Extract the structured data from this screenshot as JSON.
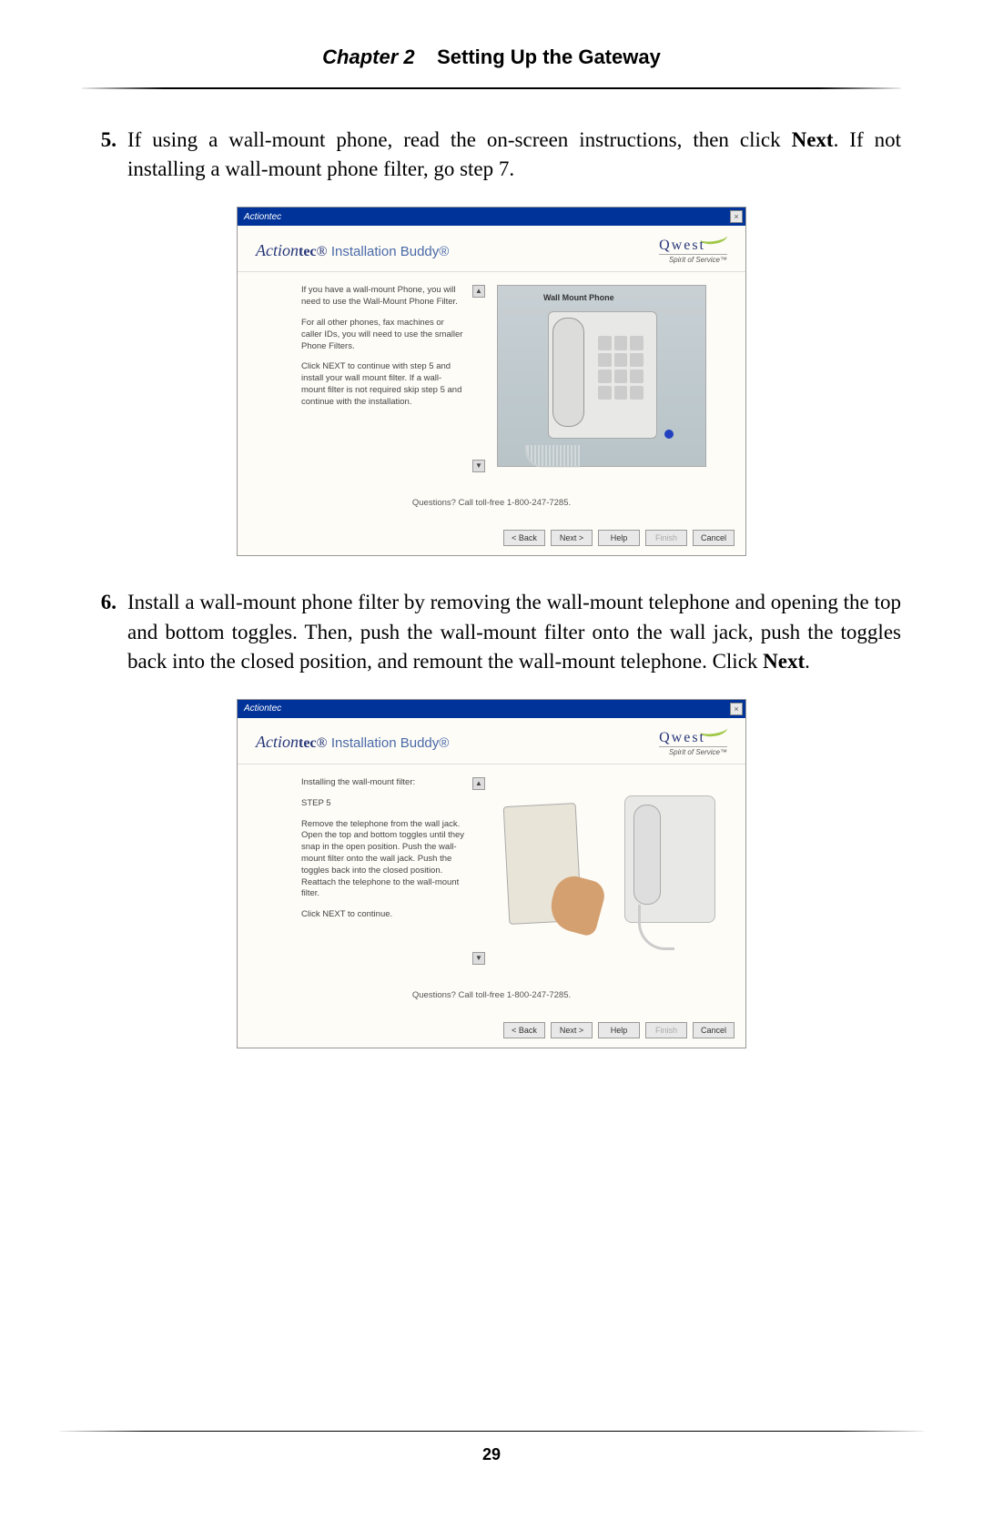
{
  "header": {
    "chapter_label": "Chapter 2",
    "chapter_title": "Setting Up the Gateway"
  },
  "steps": {
    "s5": {
      "num": "5.",
      "text_a": "If using a wall-mount phone, read the on-screen instructions, then click ",
      "text_bold": "Next",
      "text_b": ". If not installing a wall-mount phone filter, go step 7."
    },
    "s6": {
      "num": "6.",
      "text_a": "Install a wall-mount phone filter by removing the wall-mount telephone and opening the top and bottom toggles. Then, push the wall-mount filter onto the wall jack, push the toggles back into the closed position, and remount the wall-mount telephone. Click ",
      "text_bold": "Next",
      "text_b": "."
    }
  },
  "wizard_common": {
    "titlebar_app": "Actiontec",
    "close_x": "×",
    "brand_script": "Action",
    "brand_tec": "tec",
    "brand_reg": "®",
    "brand_product": " Installation Buddy®",
    "qwest_label": "Qwest",
    "qwest_tagline": "Spirit of Service™",
    "footer_q": "Questions? Call toll-free 1-800-247-7285.",
    "buttons": {
      "back": "< Back",
      "next": "Next >",
      "help": "Help",
      "finish": "Finish",
      "cancel": "Cancel"
    },
    "scroll_up": "▲",
    "scroll_down": "▼"
  },
  "wizard1": {
    "image_caption": "Wall Mount Phone",
    "p1": "If you have a wall-mount Phone, you will need to use the Wall-Mount Phone Filter.",
    "p2": "For all other phones, fax machines or caller IDs, you will need to use the smaller Phone Filters.",
    "p3": "Click NEXT to continue with step 5 and install your wall mount filter. If a wall-mount filter is not required skip step 5 and continue with the installation."
  },
  "wizard2": {
    "p1": "Installing the wall-mount filter:",
    "p2": "STEP 5",
    "p3": "Remove the telephone from the wall jack. Open the top and bottom toggles until they snap in the open position. Push the wall-mount filter onto the wall jack. Push the toggles back into the closed position. Reattach the telephone to the wall-mount filter.",
    "p4": "Click NEXT to continue."
  },
  "footer": {
    "page_num": "29"
  }
}
